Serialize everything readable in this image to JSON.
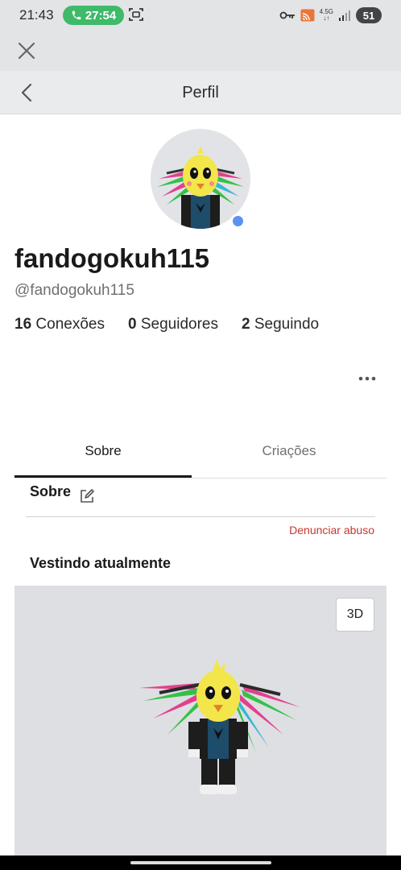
{
  "status_bar": {
    "time": "21:43",
    "call_timer": "27:54",
    "network_type": "4.5G",
    "battery": "51",
    "icons": [
      "phone-icon",
      "screen-record-icon",
      "vpn-key-icon",
      "cast-icon",
      "data-arrows-icon",
      "signal-icon",
      "battery-icon"
    ]
  },
  "header": {
    "title": "Perfil",
    "close_icon": "close-icon",
    "back_icon": "chevron-left-icon"
  },
  "profile": {
    "display_name": "fandogokuh115",
    "username": "@fandogokuh115",
    "online_status_color": "#5a93f2",
    "stats": [
      {
        "count": "16",
        "label": "Conexões"
      },
      {
        "count": "0",
        "label": "Seguidores"
      },
      {
        "count": "2",
        "label": "Seguindo"
      }
    ],
    "more_icon": "more-horizontal-icon"
  },
  "tabs": [
    {
      "label": "Sobre",
      "active": true
    },
    {
      "label": "Criações",
      "active": false
    }
  ],
  "about": {
    "title": "Sobre",
    "edit_icon": "edit-icon",
    "report_label": "Denunciar abuso",
    "report_color": "#c8372f"
  },
  "wearing": {
    "title": "Vestindo atualmente",
    "view_3d_label": "3D"
  }
}
